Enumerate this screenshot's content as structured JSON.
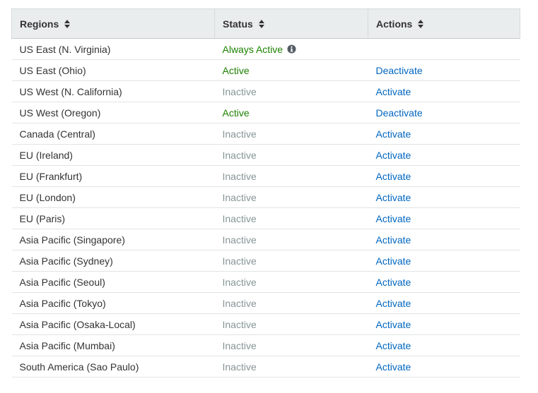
{
  "columns": {
    "regions": "Regions",
    "status": "Status",
    "actions": "Actions"
  },
  "icons": {
    "sort": "sort-icon",
    "info": "info-icon"
  },
  "colors": {
    "active": "#1d8102",
    "inactive": "#879596",
    "link": "#0066c0",
    "header_bg": "#eaeded"
  },
  "rows": [
    {
      "region": "US East (N. Virginia)",
      "status": "Always Active",
      "status_type": "active",
      "action": "",
      "info": true
    },
    {
      "region": "US East (Ohio)",
      "status": "Active",
      "status_type": "active",
      "action": "Deactivate"
    },
    {
      "region": "US West (N. California)",
      "status": "Inactive",
      "status_type": "inactive",
      "action": "Activate"
    },
    {
      "region": "US West (Oregon)",
      "status": "Active",
      "status_type": "active",
      "action": "Deactivate"
    },
    {
      "region": "Canada (Central)",
      "status": "Inactive",
      "status_type": "inactive",
      "action": "Activate"
    },
    {
      "region": "EU (Ireland)",
      "status": "Inactive",
      "status_type": "inactive",
      "action": "Activate"
    },
    {
      "region": "EU (Frankfurt)",
      "status": "Inactive",
      "status_type": "inactive",
      "action": "Activate"
    },
    {
      "region": "EU (London)",
      "status": "Inactive",
      "status_type": "inactive",
      "action": "Activate"
    },
    {
      "region": "EU (Paris)",
      "status": "Inactive",
      "status_type": "inactive",
      "action": "Activate"
    },
    {
      "region": "Asia Pacific (Singapore)",
      "status": "Inactive",
      "status_type": "inactive",
      "action": "Activate"
    },
    {
      "region": "Asia Pacific (Sydney)",
      "status": "Inactive",
      "status_type": "inactive",
      "action": "Activate"
    },
    {
      "region": "Asia Pacific (Seoul)",
      "status": "Inactive",
      "status_type": "inactive",
      "action": "Activate"
    },
    {
      "region": "Asia Pacific (Tokyo)",
      "status": "Inactive",
      "status_type": "inactive",
      "action": "Activate"
    },
    {
      "region": "Asia Pacific (Osaka-Local)",
      "status": "Inactive",
      "status_type": "inactive",
      "action": "Activate"
    },
    {
      "region": "Asia Pacific (Mumbai)",
      "status": "Inactive",
      "status_type": "inactive",
      "action": "Activate"
    },
    {
      "region": "South America (Sao Paulo)",
      "status": "Inactive",
      "status_type": "inactive",
      "action": "Activate"
    }
  ]
}
